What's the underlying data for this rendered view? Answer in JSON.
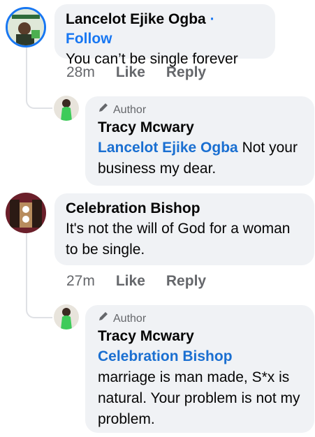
{
  "comments": [
    {
      "author": "Lancelot Ejike Ogba",
      "follow_label": "Follow",
      "separator": "·",
      "text": "You can’t be single forever",
      "time": "28m",
      "like_label": "Like",
      "reply_label": "Reply",
      "reply": {
        "badge": "Author",
        "author": "Tracy Mcwary",
        "mention": "Lancelot Ejike Ogba",
        "text": " Not your business my dear."
      }
    },
    {
      "author": "Celebration Bishop",
      "text": "It's not the will of God for a woman to be single.",
      "time": "27m",
      "like_label": "Like",
      "reply_label": "Reply",
      "reply": {
        "badge": "Author",
        "author": "Tracy Mcwary",
        "mention": "Celebration Bishop",
        "text": "marriage is man made, S*x is natural. Your problem is not my problem."
      }
    }
  ],
  "colors": {
    "link": "#1a6fd1",
    "follow": "#1877f2",
    "bubble": "#f0f2f5",
    "meta": "#65676b"
  }
}
